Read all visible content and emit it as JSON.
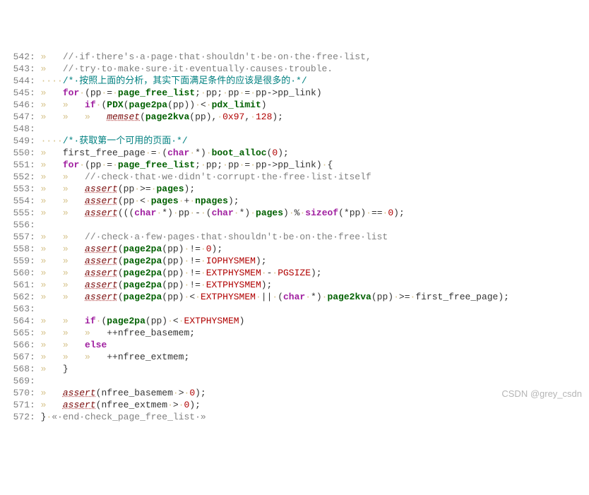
{
  "watermark": "CSDN @grey_csdn",
  "lines": [
    {
      "n": "542",
      "ws": "»   ",
      "segs": [
        {
          "c": "cm",
          "t": "//·if·there's·a·page·that·shouldn't·be·on·the·free·list,"
        }
      ]
    },
    {
      "n": "543",
      "ws": "»   ",
      "segs": [
        {
          "c": "cm",
          "t": "//·try·to·make·sure·it·eventually·causes·trouble."
        }
      ]
    },
    {
      "n": "544",
      "ws": "····",
      "segs": [
        {
          "c": "cm2",
          "t": "/*·按照上面的分析，其实下面满足条件的应该是很多的·*/"
        }
      ]
    },
    {
      "n": "545",
      "ws": "»   ",
      "segs": [
        {
          "c": "kw",
          "t": "for"
        },
        {
          "c": "ws",
          "t": "·"
        },
        {
          "c": "para",
          "t": "(pp"
        },
        {
          "c": "ws",
          "t": "·"
        },
        {
          "c": "op",
          "t": "="
        },
        {
          "c": "ws",
          "t": "·"
        },
        {
          "c": "id",
          "t": "page_free_list"
        },
        {
          "c": "para",
          "t": ";"
        },
        {
          "c": "ws",
          "t": "·"
        },
        {
          "c": "para",
          "t": "pp;"
        },
        {
          "c": "ws",
          "t": "·"
        },
        {
          "c": "para",
          "t": "pp"
        },
        {
          "c": "ws",
          "t": "·"
        },
        {
          "c": "op",
          "t": "="
        },
        {
          "c": "ws",
          "t": "·"
        },
        {
          "c": "para",
          "t": "pp->pp_link)"
        }
      ]
    },
    {
      "n": "546",
      "ws": "»   »   ",
      "segs": [
        {
          "c": "kw",
          "t": "if"
        },
        {
          "c": "ws",
          "t": "·"
        },
        {
          "c": "para",
          "t": "("
        },
        {
          "c": "id",
          "t": "PDX"
        },
        {
          "c": "para",
          "t": "("
        },
        {
          "c": "id",
          "t": "page2pa"
        },
        {
          "c": "para",
          "t": "(pp))"
        },
        {
          "c": "ws",
          "t": "·"
        },
        {
          "c": "op",
          "t": "<"
        },
        {
          "c": "ws",
          "t": "·"
        },
        {
          "c": "id",
          "t": "pdx_limit"
        },
        {
          "c": "para",
          "t": ")"
        }
      ]
    },
    {
      "n": "547",
      "ws": "»   »   »   ",
      "segs": [
        {
          "c": "call",
          "t": "memset"
        },
        {
          "c": "para",
          "t": "("
        },
        {
          "c": "id",
          "t": "page2kva"
        },
        {
          "c": "para",
          "t": "(pp),"
        },
        {
          "c": "ws",
          "t": "·"
        },
        {
          "c": "num",
          "t": "0x97"
        },
        {
          "c": "para",
          "t": ","
        },
        {
          "c": "ws",
          "t": "·"
        },
        {
          "c": "num",
          "t": "128"
        },
        {
          "c": "para",
          "t": ");"
        }
      ]
    },
    {
      "n": "548",
      "ws": "",
      "segs": []
    },
    {
      "n": "549",
      "ws": "····",
      "segs": [
        {
          "c": "cm2",
          "t": "/*·获取第一个可用的页面·*/"
        }
      ]
    },
    {
      "n": "550",
      "ws": "»   ",
      "segs": [
        {
          "c": "para",
          "t": "first_free_page"
        },
        {
          "c": "ws",
          "t": "·"
        },
        {
          "c": "op",
          "t": "="
        },
        {
          "c": "ws",
          "t": "·"
        },
        {
          "c": "para",
          "t": "("
        },
        {
          "c": "kw",
          "t": "char"
        },
        {
          "c": "ws",
          "t": "·"
        },
        {
          "c": "para",
          "t": "*)"
        },
        {
          "c": "ws",
          "t": "·"
        },
        {
          "c": "id",
          "t": "boot_alloc"
        },
        {
          "c": "para",
          "t": "("
        },
        {
          "c": "num",
          "t": "0"
        },
        {
          "c": "para",
          "t": ");"
        }
      ]
    },
    {
      "n": "551",
      "ws": "»   ",
      "segs": [
        {
          "c": "kw",
          "t": "for"
        },
        {
          "c": "ws",
          "t": "·"
        },
        {
          "c": "para",
          "t": "(pp"
        },
        {
          "c": "ws",
          "t": "·"
        },
        {
          "c": "op",
          "t": "="
        },
        {
          "c": "ws",
          "t": "·"
        },
        {
          "c": "id",
          "t": "page_free_list"
        },
        {
          "c": "para",
          "t": ";"
        },
        {
          "c": "ws",
          "t": "·"
        },
        {
          "c": "para",
          "t": "pp;"
        },
        {
          "c": "ws",
          "t": "·"
        },
        {
          "c": "para",
          "t": "pp"
        },
        {
          "c": "ws",
          "t": "·"
        },
        {
          "c": "op",
          "t": "="
        },
        {
          "c": "ws",
          "t": "·"
        },
        {
          "c": "para",
          "t": "pp->pp_link)"
        },
        {
          "c": "ws",
          "t": "·"
        },
        {
          "c": "para",
          "t": "{"
        }
      ]
    },
    {
      "n": "552",
      "ws": "»   »   ",
      "segs": [
        {
          "c": "cm",
          "t": "//·check·that·we·didn't·corrupt·the·free·list·itself"
        }
      ]
    },
    {
      "n": "553",
      "ws": "»   »   ",
      "segs": [
        {
          "c": "fn",
          "t": "assert"
        },
        {
          "c": "para",
          "t": "(pp"
        },
        {
          "c": "ws",
          "t": "·"
        },
        {
          "c": "op",
          "t": ">="
        },
        {
          "c": "ws",
          "t": "·"
        },
        {
          "c": "id",
          "t": "pages"
        },
        {
          "c": "para",
          "t": ");"
        }
      ]
    },
    {
      "n": "554",
      "ws": "»   »   ",
      "segs": [
        {
          "c": "fn",
          "t": "assert"
        },
        {
          "c": "para",
          "t": "(pp"
        },
        {
          "c": "ws",
          "t": "·"
        },
        {
          "c": "op",
          "t": "<"
        },
        {
          "c": "ws",
          "t": "·"
        },
        {
          "c": "id",
          "t": "pages"
        },
        {
          "c": "ws",
          "t": "·"
        },
        {
          "c": "op",
          "t": "+"
        },
        {
          "c": "ws",
          "t": "·"
        },
        {
          "c": "id",
          "t": "npages"
        },
        {
          "c": "para",
          "t": ");"
        }
      ]
    },
    {
      "n": "555",
      "ws": "»   »   ",
      "segs": [
        {
          "c": "fn",
          "t": "assert"
        },
        {
          "c": "para",
          "t": "((("
        },
        {
          "c": "kw",
          "t": "char"
        },
        {
          "c": "ws",
          "t": "·"
        },
        {
          "c": "para",
          "t": "*)"
        },
        {
          "c": "ws",
          "t": "·"
        },
        {
          "c": "para",
          "t": "pp"
        },
        {
          "c": "ws",
          "t": "·"
        },
        {
          "c": "op",
          "t": "-"
        },
        {
          "c": "ws",
          "t": "·"
        },
        {
          "c": "para",
          "t": "("
        },
        {
          "c": "kw",
          "t": "char"
        },
        {
          "c": "ws",
          "t": "·"
        },
        {
          "c": "para",
          "t": "*)"
        },
        {
          "c": "ws",
          "t": "·"
        },
        {
          "c": "id",
          "t": "pages"
        },
        {
          "c": "para",
          "t": ")"
        },
        {
          "c": "ws",
          "t": "·"
        },
        {
          "c": "op",
          "t": "%"
        },
        {
          "c": "ws",
          "t": "·"
        },
        {
          "c": "kw",
          "t": "sizeof"
        },
        {
          "c": "para",
          "t": "(*pp)"
        },
        {
          "c": "ws",
          "t": "·"
        },
        {
          "c": "op",
          "t": "=="
        },
        {
          "c": "ws",
          "t": "·"
        },
        {
          "c": "num",
          "t": "0"
        },
        {
          "c": "para",
          "t": ");"
        }
      ]
    },
    {
      "n": "556",
      "ws": "",
      "segs": []
    },
    {
      "n": "557",
      "ws": "»   »   ",
      "segs": [
        {
          "c": "cm",
          "t": "//·check·a·few·pages·that·shouldn't·be·on·the·free·list"
        }
      ]
    },
    {
      "n": "558",
      "ws": "»   »   ",
      "segs": [
        {
          "c": "fn",
          "t": "assert"
        },
        {
          "c": "para",
          "t": "("
        },
        {
          "c": "id",
          "t": "page2pa"
        },
        {
          "c": "para",
          "t": "(pp)"
        },
        {
          "c": "ws",
          "t": "·"
        },
        {
          "c": "op",
          "t": "!="
        },
        {
          "c": "ws",
          "t": "·"
        },
        {
          "c": "num",
          "t": "0"
        },
        {
          "c": "para",
          "t": ");"
        }
      ]
    },
    {
      "n": "559",
      "ws": "»   »   ",
      "segs": [
        {
          "c": "fn",
          "t": "assert"
        },
        {
          "c": "para",
          "t": "("
        },
        {
          "c": "id",
          "t": "page2pa"
        },
        {
          "c": "para",
          "t": "(pp)"
        },
        {
          "c": "ws",
          "t": "·"
        },
        {
          "c": "op",
          "t": "!="
        },
        {
          "c": "ws",
          "t": "·"
        },
        {
          "c": "num",
          "t": "IOPHYSMEM"
        },
        {
          "c": "para",
          "t": ");"
        }
      ]
    },
    {
      "n": "560",
      "ws": "»   »   ",
      "segs": [
        {
          "c": "fn",
          "t": "assert"
        },
        {
          "c": "para",
          "t": "("
        },
        {
          "c": "id",
          "t": "page2pa"
        },
        {
          "c": "para",
          "t": "(pp)"
        },
        {
          "c": "ws",
          "t": "·"
        },
        {
          "c": "op",
          "t": "!="
        },
        {
          "c": "ws",
          "t": "·"
        },
        {
          "c": "num",
          "t": "EXTPHYSMEM"
        },
        {
          "c": "ws",
          "t": "·"
        },
        {
          "c": "op",
          "t": "-"
        },
        {
          "c": "ws",
          "t": "·"
        },
        {
          "c": "num",
          "t": "PGSIZE"
        },
        {
          "c": "para",
          "t": ");"
        }
      ]
    },
    {
      "n": "561",
      "ws": "»   »   ",
      "segs": [
        {
          "c": "fn",
          "t": "assert"
        },
        {
          "c": "para",
          "t": "("
        },
        {
          "c": "id",
          "t": "page2pa"
        },
        {
          "c": "para",
          "t": "(pp)"
        },
        {
          "c": "ws",
          "t": "·"
        },
        {
          "c": "op",
          "t": "!="
        },
        {
          "c": "ws",
          "t": "·"
        },
        {
          "c": "num",
          "t": "EXTPHYSMEM"
        },
        {
          "c": "para",
          "t": ");"
        }
      ]
    },
    {
      "n": "562",
      "ws": "»   »   ",
      "segs": [
        {
          "c": "fn",
          "t": "assert"
        },
        {
          "c": "para",
          "t": "("
        },
        {
          "c": "id",
          "t": "page2pa"
        },
        {
          "c": "para",
          "t": "(pp)"
        },
        {
          "c": "ws",
          "t": "·"
        },
        {
          "c": "op",
          "t": "<"
        },
        {
          "c": "ws",
          "t": "·"
        },
        {
          "c": "num",
          "t": "EXTPHYSMEM"
        },
        {
          "c": "ws",
          "t": "·"
        },
        {
          "c": "op",
          "t": "||"
        },
        {
          "c": "ws",
          "t": "·"
        },
        {
          "c": "para",
          "t": "("
        },
        {
          "c": "kw",
          "t": "char"
        },
        {
          "c": "ws",
          "t": "·"
        },
        {
          "c": "para",
          "t": "*)"
        },
        {
          "c": "ws",
          "t": "·"
        },
        {
          "c": "id",
          "t": "page2kva"
        },
        {
          "c": "para",
          "t": "(pp)"
        },
        {
          "c": "ws",
          "t": "·"
        },
        {
          "c": "op",
          "t": ">="
        },
        {
          "c": "ws",
          "t": "·"
        },
        {
          "c": "para",
          "t": "first_free_page);"
        }
      ]
    },
    {
      "n": "563",
      "ws": "",
      "segs": []
    },
    {
      "n": "564",
      "ws": "»   »   ",
      "segs": [
        {
          "c": "kw",
          "t": "if"
        },
        {
          "c": "ws",
          "t": "·"
        },
        {
          "c": "para",
          "t": "("
        },
        {
          "c": "id",
          "t": "page2pa"
        },
        {
          "c": "para",
          "t": "(pp)"
        },
        {
          "c": "ws",
          "t": "·"
        },
        {
          "c": "op",
          "t": "<"
        },
        {
          "c": "ws",
          "t": "·"
        },
        {
          "c": "num",
          "t": "EXTPHYSMEM"
        },
        {
          "c": "para",
          "t": ")"
        }
      ]
    },
    {
      "n": "565",
      "ws": "»   »   »   ",
      "segs": [
        {
          "c": "para",
          "t": "++nfree_basemem;"
        }
      ]
    },
    {
      "n": "566",
      "ws": "»   »   ",
      "segs": [
        {
          "c": "kw",
          "t": "else"
        }
      ]
    },
    {
      "n": "567",
      "ws": "»   »   »   ",
      "segs": [
        {
          "c": "para",
          "t": "++nfree_extmem;"
        }
      ]
    },
    {
      "n": "568",
      "ws": "»   ",
      "segs": [
        {
          "c": "para",
          "t": "}"
        }
      ]
    },
    {
      "n": "569",
      "ws": "",
      "segs": []
    },
    {
      "n": "570",
      "ws": "»   ",
      "segs": [
        {
          "c": "fn",
          "t": "assert"
        },
        {
          "c": "para",
          "t": "(nfree_basemem"
        },
        {
          "c": "ws",
          "t": "·"
        },
        {
          "c": "op",
          "t": ">"
        },
        {
          "c": "ws",
          "t": "·"
        },
        {
          "c": "num",
          "t": "0"
        },
        {
          "c": "para",
          "t": ");"
        }
      ]
    },
    {
      "n": "571",
      "ws": "»   ",
      "segs": [
        {
          "c": "fn",
          "t": "assert"
        },
        {
          "c": "para",
          "t": "(nfree_extmem"
        },
        {
          "c": "ws",
          "t": "·"
        },
        {
          "c": "op",
          "t": ">"
        },
        {
          "c": "ws",
          "t": "·"
        },
        {
          "c": "num",
          "t": "0"
        },
        {
          "c": "para",
          "t": ");"
        }
      ]
    },
    {
      "n": "572",
      "ws": "",
      "segs": [
        {
          "c": "para",
          "t": "}"
        },
        {
          "c": "ws",
          "t": "·"
        },
        {
          "c": "cm",
          "t": "«·end·check_page_free_list·»"
        }
      ]
    }
  ]
}
